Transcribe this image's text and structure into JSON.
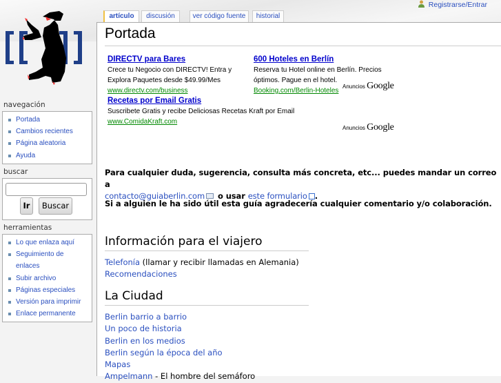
{
  "personal": {
    "login": "Registrarse/Entrar"
  },
  "tabs": [
    {
      "label": "artículo",
      "selected": true
    },
    {
      "label": "discusión"
    },
    {
      "label": "ver código fuente"
    },
    {
      "label": "historial"
    }
  ],
  "page_title": "Portada",
  "ads": [
    {
      "title": "DIRECTV para Bares",
      "text": "Crece tu Negocio con DIRECTV! Entra y Explora Paquetes desde $49.99/Mes",
      "url": "www.directv.com/business"
    },
    {
      "title": "600 Hoteles en Berlín",
      "text": "Reserva tu Hotel online en Berlín. Precios óptimos. Pague en el hotel.",
      "url": "Booking.com/Berlin-Hoteles"
    },
    {
      "title": "Recetas por Email Gratis",
      "text": "Suscribete Gratis y recibe Deliciosas Recetas Kraft por Email",
      "url": "www.ComidaKraft.com"
    }
  ],
  "ads_label": {
    "prefix": "Anuncios",
    "brand": "Google"
  },
  "intro": {
    "line1": "Para cualquier duda, sugerencia, consulta más concreta, etc... puedes mandar un correo a",
    "email": "contacto@guiaberlin.com",
    "mid": " o usar ",
    "form_link": "este formulario",
    "end": ".",
    "thanks": "Si a alguien le ha sido útil esta guía agradecería cualquier comentario y/o colaboración."
  },
  "sections": [
    {
      "title": "Información para el viajero",
      "items": [
        {
          "link": "Telefonía",
          "note": " (llamar y recibir llamadas en Alemania)"
        },
        {
          "link": "Recomendaciones",
          "note": ""
        }
      ]
    },
    {
      "title": "La Ciudad",
      "items": [
        {
          "link": "Berlin barrio a barrio",
          "note": ""
        },
        {
          "link": "Un poco de historia",
          "note": ""
        },
        {
          "link": "Berlin en los medios",
          "note": ""
        },
        {
          "link": "Berlin según la época del año",
          "note": ""
        },
        {
          "link": "Mapas",
          "note": ""
        },
        {
          "link": "Ampelmann",
          "note": " - El hombre del semáforo"
        }
      ]
    }
  ],
  "sidebar": {
    "nav_title": "navegación",
    "nav": [
      "Portada",
      "Cambios recientes",
      "Página aleatoria",
      "Ayuda"
    ],
    "search_title": "buscar",
    "search_value": "",
    "go": "Ir",
    "search": "Buscar",
    "tools_title": "herramientas",
    "tools": [
      "Lo que enlaza aquí",
      "Seguimiento de enlaces",
      "Subir archivo",
      "Páginas especiales",
      "Versión para imprimir",
      "Enlace permanente"
    ]
  }
}
